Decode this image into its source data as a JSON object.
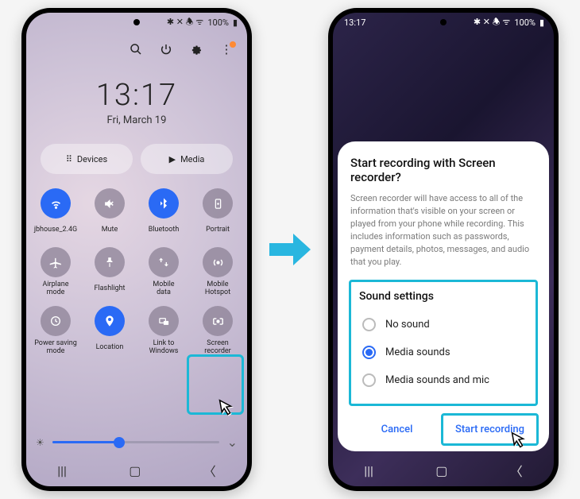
{
  "status": {
    "time": "13:17",
    "battery": "100%",
    "icons": "✱ ✕ ✆ ᯤ"
  },
  "clock": {
    "time": "13:17",
    "date": "Fri, March 19"
  },
  "chips": {
    "devices": "Devices",
    "media": "Media"
  },
  "qs": [
    {
      "label": "jbhouse_2.4G",
      "active": true,
      "icon": "wifi"
    },
    {
      "label": "Mute",
      "active": false,
      "icon": "mute"
    },
    {
      "label": "Bluetooth",
      "active": true,
      "icon": "bt"
    },
    {
      "label": "Portrait",
      "active": false,
      "icon": "portrait"
    },
    {
      "label": "Airplane\nmode",
      "active": false,
      "icon": "plane"
    },
    {
      "label": "Flashlight",
      "active": false,
      "icon": "flash"
    },
    {
      "label": "Mobile\ndata",
      "active": false,
      "icon": "mdata"
    },
    {
      "label": "Mobile\nHotspot",
      "active": false,
      "icon": "hotspot"
    },
    {
      "label": "Power saving\nmode",
      "active": false,
      "icon": "psm"
    },
    {
      "label": "Location",
      "active": true,
      "icon": "loc"
    },
    {
      "label": "Link to\nWindows",
      "active": false,
      "icon": "link"
    },
    {
      "label": "Screen\nrecorder",
      "active": false,
      "icon": "rec"
    }
  ],
  "brightness": 40,
  "dialog": {
    "title": "Start recording with Screen recorder?",
    "body": "Screen recorder will have access to all of the information that's visible on your screen or played from your phone while recording. This includes information such as passwords, payment details, photos, messages, and audio that you play.",
    "sound_title": "Sound settings",
    "options": [
      {
        "label": "No sound",
        "checked": false
      },
      {
        "label": "Media sounds",
        "checked": true
      },
      {
        "label": "Media sounds and mic",
        "checked": false
      }
    ],
    "cancel": "Cancel",
    "start": "Start recording"
  }
}
